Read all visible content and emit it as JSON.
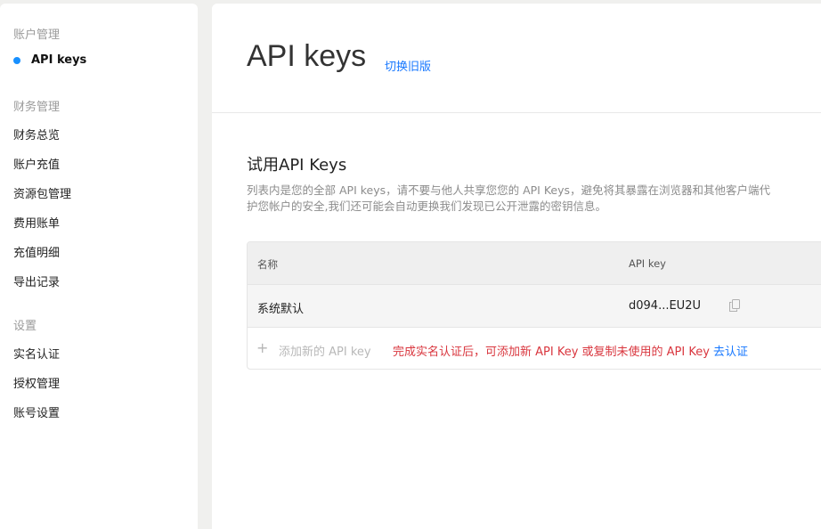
{
  "sidebar": {
    "groups": [
      {
        "title": "账户管理",
        "items": [
          {
            "label": "API keys",
            "active": true
          }
        ]
      },
      {
        "title": "财务管理",
        "items": [
          {
            "label": "财务总览"
          },
          {
            "label": "账户充值"
          },
          {
            "label": "资源包管理"
          },
          {
            "label": "费用账单"
          },
          {
            "label": "充值明细"
          },
          {
            "label": "导出记录"
          }
        ]
      },
      {
        "title": "设置",
        "items": [
          {
            "label": "实名认证"
          },
          {
            "label": "授权管理"
          },
          {
            "label": "账号设置"
          }
        ]
      }
    ]
  },
  "header": {
    "title": "API keys",
    "switch_link": "切换旧版"
  },
  "section": {
    "title": "试用API Keys",
    "description_line1": "列表内是您的全部 API keys，请不要与他人共享您您的 API Keys，避免将其暴露在浏览器和其他客户端代",
    "description_line2": "护您帐户的安全,我们还可能会自动更换我们发现已公开泄露的密钥信息。"
  },
  "table": {
    "columns": [
      "名称",
      "API key"
    ],
    "rows": [
      {
        "name": "系统默认",
        "key": "d094...EU2U"
      }
    ],
    "add_label": "添加新的 API key",
    "warning": "完成实名认证后，可添加新 API Key 或复制未使用的 API Key",
    "verify_link": "去认证"
  },
  "colors": {
    "accent": "#1677ff",
    "active_dot": "#1890ff",
    "warning": "#d9363e"
  }
}
